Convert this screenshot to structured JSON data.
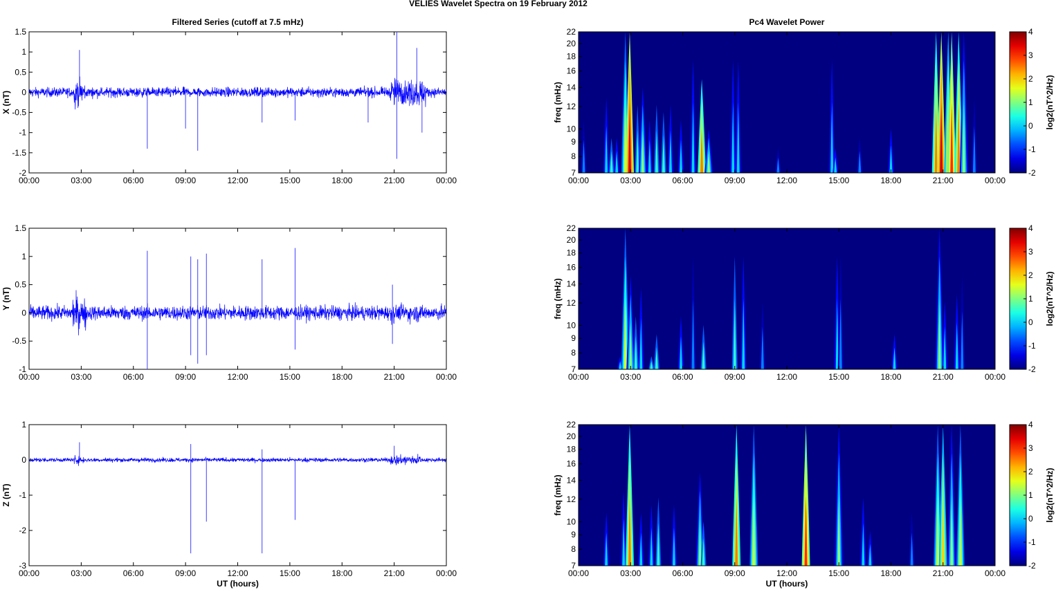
{
  "title": "VELIES Wavelet Spectra on 19 February  2012",
  "chart_data": [
    {
      "type": "line",
      "title": "Filtered Series (cutoff at 7.5 mHz)",
      "ylabel": "X (nT)",
      "xlabel": "",
      "ylim": [
        -2,
        1.5
      ],
      "yticks": [
        "-2",
        "-1.5",
        "-1",
        "-0.5",
        "0",
        "0.5",
        "1",
        "1.5"
      ],
      "xticks": [
        "00:00",
        "03:00",
        "06:00",
        "09:00",
        "12:00",
        "15:00",
        "18:00",
        "21:00",
        "00:00"
      ],
      "xlim_hours": [
        0,
        24
      ],
      "color": "#0000ff",
      "noise_amplitude": 0.12,
      "active_intervals": [
        [
          2.6,
          3.3,
          0.4
        ],
        [
          20.8,
          22.8,
          0.45
        ]
      ],
      "spikes": [
        [
          2.9,
          1.05
        ],
        [
          6.8,
          -1.4
        ],
        [
          9.0,
          -0.9
        ],
        [
          9.7,
          -1.45
        ],
        [
          13.4,
          -0.75
        ],
        [
          15.3,
          -0.7
        ],
        [
          19.5,
          -0.75
        ],
        [
          21.15,
          1.5
        ],
        [
          21.15,
          -1.65
        ],
        [
          22.3,
          1.1
        ],
        [
          22.6,
          -1.0
        ]
      ]
    },
    {
      "type": "line",
      "title": "",
      "ylabel": "Y (nT)",
      "xlabel": "",
      "ylim": [
        -1,
        1.5
      ],
      "yticks": [
        "-1",
        "-0.5",
        "0",
        "0.5",
        "1",
        "1.5"
      ],
      "xticks": [
        "00:00",
        "03:00",
        "06:00",
        "09:00",
        "12:00",
        "15:00",
        "18:00",
        "21:00",
        "00:00"
      ],
      "xlim_hours": [
        0,
        24
      ],
      "color": "#0000ff",
      "noise_amplitude": 0.13,
      "active_intervals": [
        [
          2.5,
          3.3,
          0.35
        ],
        [
          20.7,
          22.5,
          0.2
        ]
      ],
      "spikes": [
        [
          6.8,
          -1.0
        ],
        [
          6.8,
          1.1
        ],
        [
          9.3,
          1.0
        ],
        [
          9.3,
          -0.75
        ],
        [
          9.7,
          0.95
        ],
        [
          9.7,
          -0.9
        ],
        [
          10.2,
          1.05
        ],
        [
          10.2,
          -0.75
        ],
        [
          13.4,
          0.95
        ],
        [
          15.3,
          1.15
        ],
        [
          15.3,
          -0.65
        ],
        [
          20.9,
          0.5
        ],
        [
          20.9,
          -0.55
        ]
      ]
    },
    {
      "type": "line",
      "title": "",
      "ylabel": "Z (nT)",
      "xlabel": "UT (hours)",
      "ylim": [
        -3,
        1
      ],
      "yticks": [
        "-3",
        "-2",
        "-1",
        "0",
        "1"
      ],
      "xticks": [
        "00:00",
        "03:00",
        "06:00",
        "09:00",
        "12:00",
        "15:00",
        "18:00",
        "21:00",
        "00:00"
      ],
      "xlim_hours": [
        0,
        24
      ],
      "color": "#0000ff",
      "noise_amplitude": 0.06,
      "active_intervals": [
        [
          2.6,
          3.2,
          0.15
        ],
        [
          20.8,
          22.5,
          0.2
        ]
      ],
      "spikes": [
        [
          2.9,
          0.5
        ],
        [
          9.3,
          -2.65
        ],
        [
          9.3,
          0.45
        ],
        [
          10.2,
          -1.75
        ],
        [
          13.4,
          -2.65
        ],
        [
          13.4,
          0.3
        ],
        [
          15.3,
          -1.7
        ],
        [
          21.0,
          0.4
        ]
      ]
    },
    {
      "type": "heatmap",
      "title": "Pc4 Wavelet Power",
      "ylabel": "freq (mHz)",
      "xlabel": "",
      "ylim": [
        7,
        22
      ],
      "yticks": [
        "7",
        "8",
        "9",
        "10",
        "12",
        "14",
        "16",
        "18",
        "20",
        "22"
      ],
      "xticks": [
        "00:00",
        "03:00",
        "06:00",
        "09:00",
        "12:00",
        "15:00",
        "18:00",
        "21:00",
        "00:00"
      ],
      "colorbar": {
        "label": "log2(nT^2/Hz)",
        "range": [
          -2,
          4
        ],
        "ticks": [
          "-2",
          "-1",
          "0",
          "1",
          "2",
          "3",
          "4"
        ]
      },
      "bursts_time_topfreq_peak": [
        [
          0.3,
          12,
          -0.5
        ],
        [
          1.6,
          15,
          0
        ],
        [
          1.9,
          10,
          0.5
        ],
        [
          2.2,
          10,
          0
        ],
        [
          2.7,
          22,
          1.5
        ],
        [
          2.95,
          22,
          3.5
        ],
        [
          3.4,
          14,
          0.5
        ],
        [
          3.7,
          14,
          1
        ],
        [
          4.1,
          12,
          0
        ],
        [
          4.5,
          14,
          0.5
        ],
        [
          4.9,
          13,
          0.5
        ],
        [
          5.3,
          14,
          0
        ],
        [
          5.9,
          12,
          0
        ],
        [
          6.6,
          22,
          0
        ],
        [
          7.1,
          15,
          2.5
        ],
        [
          7.5,
          10,
          1
        ],
        [
          8.9,
          22,
          0
        ],
        [
          9.2,
          22,
          0
        ],
        [
          11.5,
          9,
          -0.5
        ],
        [
          14.6,
          22,
          0
        ],
        [
          14.8,
          9,
          0
        ],
        [
          16.2,
          10,
          -0.5
        ],
        [
          18.0,
          11,
          0
        ],
        [
          20.6,
          22,
          2.5
        ],
        [
          20.9,
          22,
          3.5
        ],
        [
          21.3,
          22,
          2
        ],
        [
          21.5,
          22,
          3
        ],
        [
          21.9,
          22,
          2.5
        ],
        [
          22.2,
          22,
          1
        ],
        [
          22.8,
          15,
          -0.5
        ]
      ]
    },
    {
      "type": "heatmap",
      "title": "",
      "ylabel": "freq (mHz)",
      "xlabel": "",
      "ylim": [
        7,
        22
      ],
      "yticks": [
        "7",
        "8",
        "9",
        "10",
        "12",
        "14",
        "16",
        "18",
        "20",
        "22"
      ],
      "xticks": [
        "00:00",
        "03:00",
        "06:00",
        "09:00",
        "12:00",
        "15:00",
        "18:00",
        "21:00",
        "00:00"
      ],
      "colorbar": {
        "label": "log2(nT^2/Hz)",
        "range": [
          -2,
          4
        ],
        "ticks": [
          "-2",
          "-1",
          "0",
          "1",
          "2",
          "3",
          "4"
        ]
      },
      "bursts_time_topfreq_peak": [
        [
          2.4,
          8,
          0
        ],
        [
          2.7,
          22,
          1.5
        ],
        [
          3.0,
          15,
          1
        ],
        [
          3.3,
          12,
          0.5
        ],
        [
          3.6,
          16,
          0
        ],
        [
          4.2,
          8,
          0.5
        ],
        [
          4.5,
          10,
          0.5
        ],
        [
          5.9,
          12,
          0
        ],
        [
          6.6,
          22,
          -0.5
        ],
        [
          7.2,
          11,
          0.5
        ],
        [
          9.0,
          22,
          0.5
        ],
        [
          9.5,
          22,
          0
        ],
        [
          10.6,
          14,
          -0.5
        ],
        [
          14.9,
          22,
          0
        ],
        [
          15.1,
          22,
          -0.5
        ],
        [
          18.2,
          10,
          0
        ],
        [
          20.8,
          22,
          1
        ],
        [
          21.1,
          14,
          0
        ],
        [
          21.8,
          15,
          0
        ],
        [
          22.1,
          18,
          -0.5
        ]
      ]
    },
    {
      "type": "heatmap",
      "title": "",
      "ylabel": "freq (mHz)",
      "xlabel": "UT (hours)",
      "ylim": [
        7,
        22
      ],
      "yticks": [
        "7",
        "8",
        "9",
        "10",
        "12",
        "14",
        "16",
        "18",
        "20",
        "22"
      ],
      "xticks": [
        "00:00",
        "03:00",
        "06:00",
        "09:00",
        "12:00",
        "15:00",
        "18:00",
        "21:00",
        "00:00"
      ],
      "colorbar": {
        "label": "log2(nT^2/Hz)",
        "range": [
          -2,
          4
        ],
        "ticks": [
          "-2",
          "-1",
          "0",
          "1",
          "2",
          "3",
          "4"
        ]
      },
      "bursts_time_topfreq_peak": [
        [
          1.6,
          12,
          0
        ],
        [
          2.6,
          15,
          0
        ],
        [
          2.95,
          22,
          2.5
        ],
        [
          3.6,
          12,
          0
        ],
        [
          4.2,
          13,
          0
        ],
        [
          4.6,
          14,
          0.5
        ],
        [
          5.5,
          13,
          0
        ],
        [
          7.0,
          15,
          1
        ],
        [
          7.2,
          11,
          0.5
        ],
        [
          9.1,
          22,
          2.5
        ],
        [
          10.1,
          22,
          1.5
        ],
        [
          13.1,
          22,
          3
        ],
        [
          15.0,
          22,
          1
        ],
        [
          16.4,
          14,
          0
        ],
        [
          16.8,
          10,
          0
        ],
        [
          19.2,
          12,
          -0.5
        ],
        [
          20.7,
          22,
          1.5
        ],
        [
          21.0,
          22,
          2
        ],
        [
          21.5,
          22,
          1
        ],
        [
          22.0,
          22,
          1.5
        ]
      ]
    }
  ]
}
